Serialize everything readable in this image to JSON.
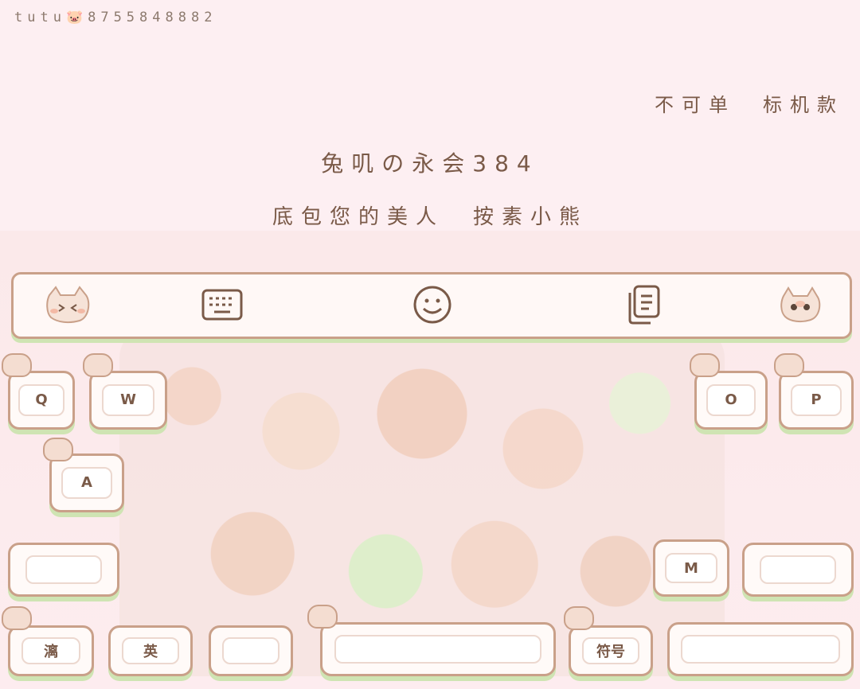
{
  "header": {
    "id_text": "tutu🐷8755848882"
  },
  "text_lines": {
    "line1": "不可单　标机款",
    "line2": "兔叽の永会384",
    "line3": "底包您的美人　按素小熊"
  },
  "toolbar": {
    "icons": [
      "cat-sticker-icon",
      "keyboard-icon",
      "emoji-icon",
      "clipboard-icon",
      "cat-sticker-icon"
    ]
  },
  "keys": {
    "q": "Q",
    "w": "W",
    "o": "O",
    "p": "P",
    "a": "A",
    "m": "M",
    "symbols_left": "符号",
    "lang_left": "英",
    "mode_left": "漓",
    "space": "",
    "symbols_right": "符号"
  },
  "colors": {
    "background": "#fdeff2",
    "outline": "#c9a089",
    "key_shadow": "#cfe4b3",
    "text": "#7a5a48"
  }
}
